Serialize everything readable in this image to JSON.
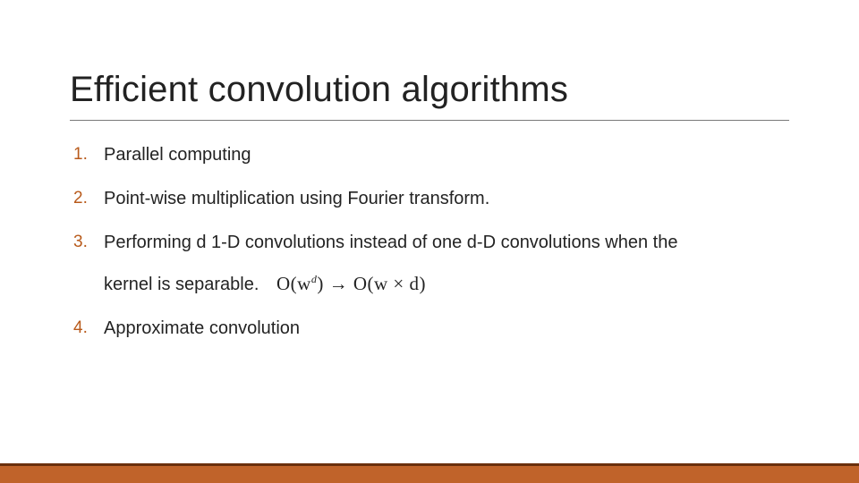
{
  "title": "Efficient convolution algorithms",
  "items": [
    {
      "num": "1.",
      "text": "Parallel computing"
    },
    {
      "num": "2.",
      "text": "Point-wise multiplication using Fourier transform."
    },
    {
      "num": "3.",
      "text": "Performing d 1-D convolutions instead of one d-D convolutions when the",
      "text2": "kernel is separable.",
      "math_from": "O(w",
      "math_from_sup": "d",
      "math_from_close": ")",
      "math_arrow": " → ",
      "math_to": "O(w × d)"
    },
    {
      "num": "4.",
      "text": "Approximate convolution"
    }
  ]
}
